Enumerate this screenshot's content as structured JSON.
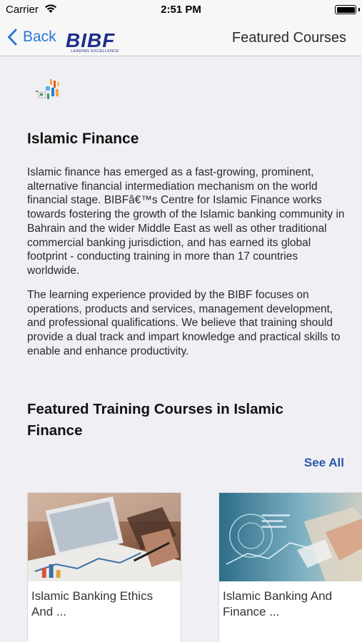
{
  "status_bar": {
    "carrier": "Carrier",
    "time": "2:51 PM"
  },
  "nav": {
    "back_label": "Back",
    "logo_text": "BIBF",
    "logo_tagline": "LEADING EXCELLENCE",
    "title": "Featured Courses"
  },
  "page": {
    "heading": "Islamic Finance",
    "paragraph_1": "Islamic finance has emerged as a fast-growing, prominent, alternative financial intermediation mechanism on the world financial stage. BIBFâ€™s Centre for Islamic Finance works towards fostering the growth of the Islamic banking community in Bahrain and the wider Middle East as well as other traditional commercial banking jurisdiction, and has earned its global footprint - conducting training in more than 17 countries worldwide.",
    "paragraph_2": "The learning experience provided by the BIBF focuses on operations, products and services, management development, and professional qualifications. We believe that training should provide a dual track and impart knowledge and practical skills to enable and enhance productivity.",
    "featured_heading": "Featured Training Courses in Islamic Finance",
    "see_all": "See All"
  },
  "courses": [
    {
      "title": "Islamic Banking Ethics And ...",
      "image": "laptop-charts-photo"
    },
    {
      "title": "Islamic Banking And Finance ...",
      "image": "digital-finance-photo"
    }
  ],
  "colors": {
    "accent": "#2b78d8",
    "see_all": "#2a56a8",
    "brand": "#1f2f8a",
    "background": "#efeff4"
  }
}
